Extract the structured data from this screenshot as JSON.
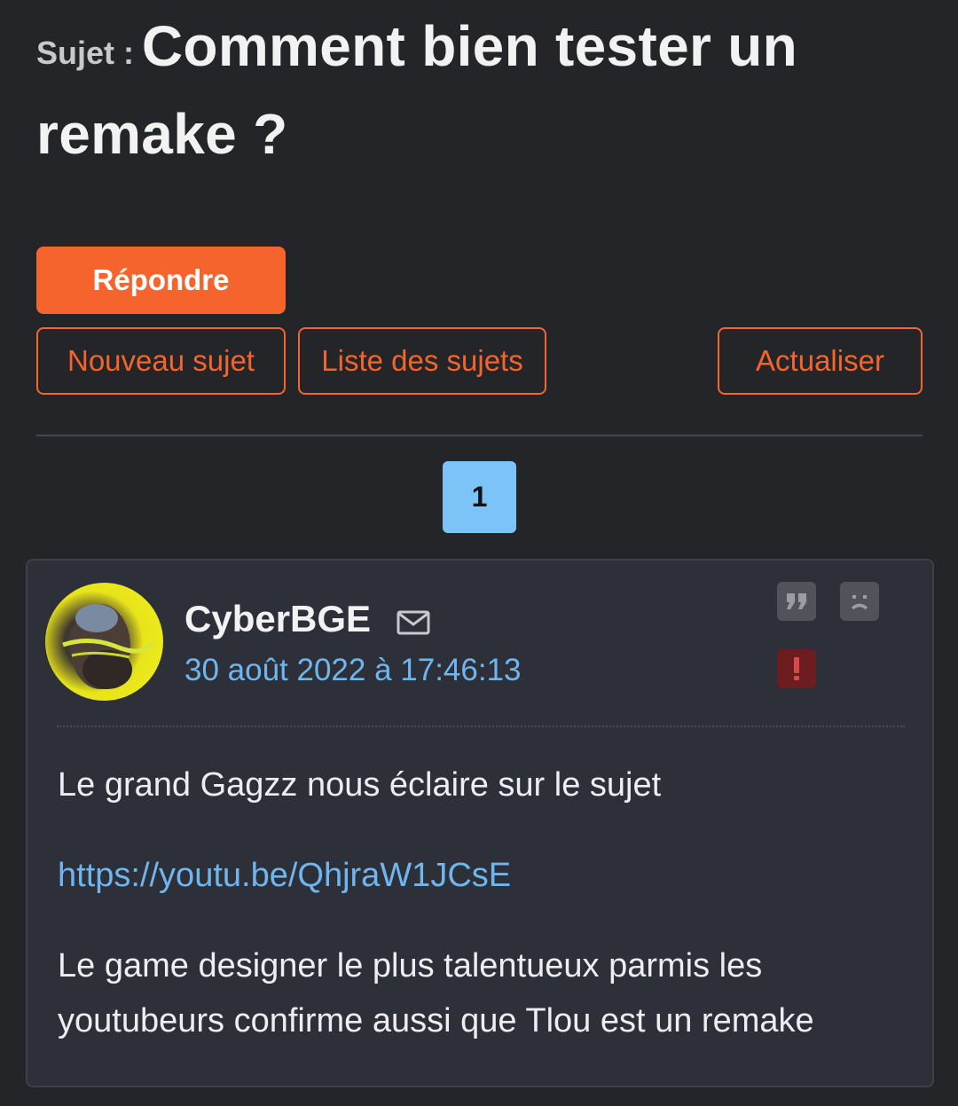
{
  "topic": {
    "prefix": "Sujet :",
    "title": "Comment bien tester un remake ?"
  },
  "actions": {
    "reply_label": "Répondre",
    "new_topic_label": "Nouveau sujet",
    "topic_list_label": "Liste des sujets",
    "refresh_label": "Actualiser"
  },
  "pagination": {
    "current_page": "1"
  },
  "post": {
    "author": "CyberBGE",
    "date": "30 août 2022 à 17:46:13",
    "icons": [
      "mail-icon",
      "quote-icon",
      "sad-face-icon",
      "report-icon"
    ],
    "paragraph_1": "Le grand Gagzz nous éclaire sur le sujet",
    "link": "https://youtu.be/QhjraW1JCsE",
    "paragraph_2": "Le game designer le plus talentueux parmis les youtubeurs confirme aussi que Tlou est un remake"
  },
  "colors": {
    "background": "#232529",
    "accent": "#f4642c",
    "link": "#6fb6ef",
    "page_active": "#7cc4f7",
    "report": "#6b1d1f"
  }
}
